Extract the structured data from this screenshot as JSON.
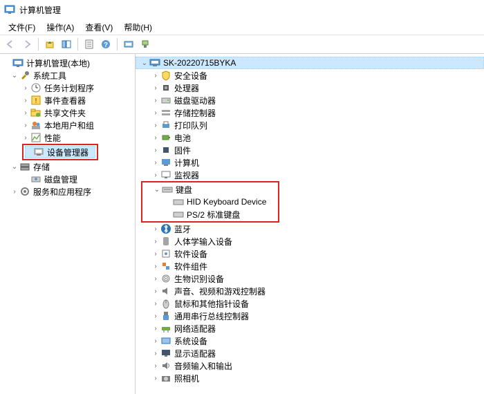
{
  "window": {
    "title": "计算机管理"
  },
  "menu": {
    "file": "文件(F)",
    "action": "操作(A)",
    "view": "查看(V)",
    "help": "帮助(H)"
  },
  "left": {
    "root": "计算机管理(本地)",
    "systools": "系统工具",
    "task": "任务计划程序",
    "event": "事件查看器",
    "share": "共享文件夹",
    "users": "本地用户和组",
    "perf": "性能",
    "devmgr": "设备管理器",
    "storage": "存储",
    "diskmgr": "磁盘管理",
    "services": "服务和应用程序"
  },
  "right": {
    "root": "SK-20220715BYKA",
    "items": {
      "security": "安全设备",
      "cpu": "处理器",
      "diskdrive": "磁盘驱动器",
      "storagectrl": "存储控制器",
      "printqueue": "打印队列",
      "battery": "电池",
      "firmware": "固件",
      "computer": "计算机",
      "monitor": "监视器",
      "keyboard": "键盘",
      "kb1": "HID Keyboard Device",
      "kb2": "PS/2 标准键盘",
      "bluetooth": "蓝牙",
      "hid": "人体学输入设备",
      "softdev": "软件设备",
      "softcomp": "软件组件",
      "biometric": "生物识别设备",
      "audiovideo": "声音、视频和游戏控制器",
      "mouse": "鼠标和其他指针设备",
      "usb": "通用串行总线控制器",
      "network": "网络适配器",
      "sysdev": "系统设备",
      "display": "显示适配器",
      "audioio": "音频输入和输出",
      "camera": "照相机"
    }
  }
}
